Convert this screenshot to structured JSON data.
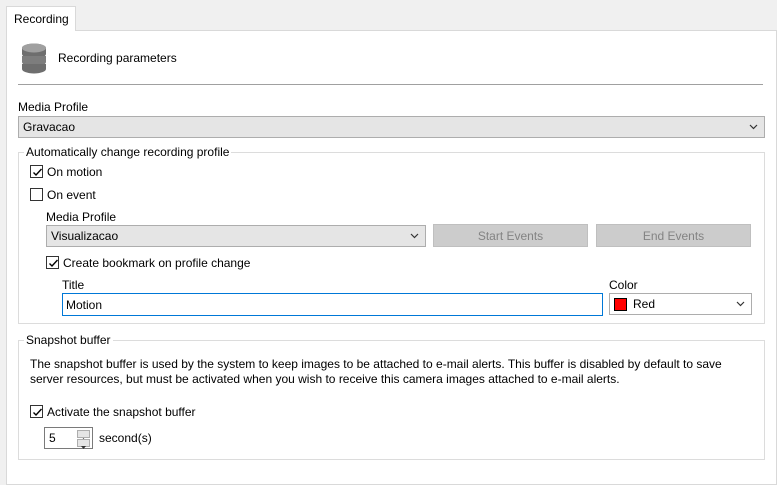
{
  "tab": {
    "label": "Recording"
  },
  "header": {
    "title": "Recording parameters",
    "icon": "database-icon"
  },
  "media_profile": {
    "label": "Media Profile",
    "value": "Gravacao"
  },
  "auto_change": {
    "legend": "Automatically change recording profile",
    "on_motion": {
      "label": "On motion",
      "checked": true
    },
    "on_event": {
      "label": "On event",
      "checked": false
    },
    "profile_label": "Media Profile",
    "profile_value": "Visualizacao",
    "start_events_label": "Start Events",
    "end_events_label": "End Events",
    "bookmark": {
      "label": "Create bookmark on profile change",
      "checked": true
    },
    "title_label": "Title",
    "title_value": "Motion",
    "color_label": "Color",
    "color_value": "Red",
    "color_hex": "#ff0000"
  },
  "snapshot": {
    "legend": "Snapshot buffer",
    "description": "The snapshot buffer is used by the system to keep images to be attached to e-mail alerts. This buffer is disabled by default to save server resources, but must be activated when you wish to receive this camera images attached to e-mail alerts.",
    "activate": {
      "label": "Activate the snapshot buffer",
      "checked": true
    },
    "seconds_value": "5",
    "seconds_unit": "second(s)"
  }
}
